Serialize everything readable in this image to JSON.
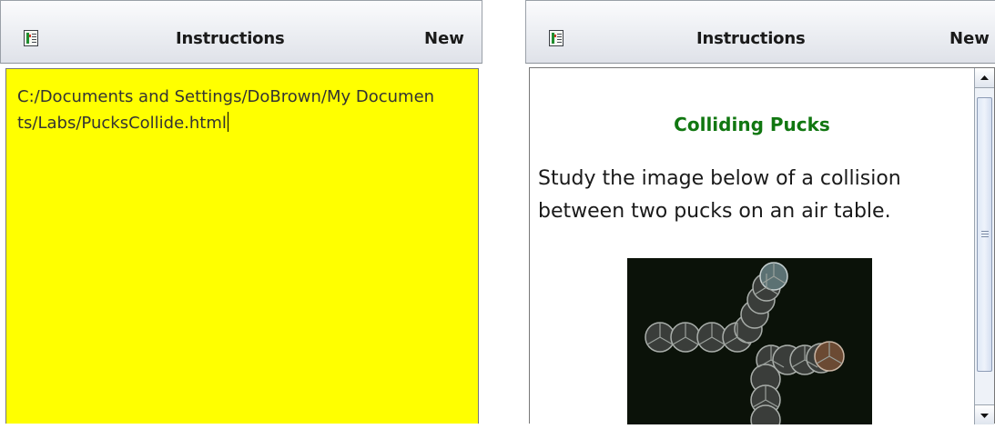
{
  "left_panel": {
    "toolbar": {
      "icon": "document-icon",
      "title": "Instructions",
      "new_label": "New"
    },
    "editor": {
      "background_color": "#ffff00",
      "value": "C:/Documents and Settings/DoBrown/My Documents/Labs/PucksCollide.html"
    }
  },
  "right_panel": {
    "toolbar": {
      "icon": "document-icon",
      "title": "Instructions",
      "new_label": "New"
    },
    "content": {
      "heading": "Colliding Pucks",
      "heading_color": "#117711",
      "paragraph": "Study the image below of a collision between two pucks on an air table."
    },
    "scrollbar": {
      "up_icon": "scroll-up-arrow-icon",
      "down_icon": "scroll-down-arrow-icon"
    }
  }
}
